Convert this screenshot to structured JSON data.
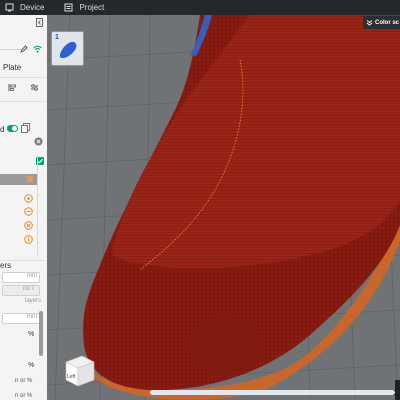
{
  "topbar": {
    "tabs": [
      {
        "label": "Device",
        "icon": "device-icon"
      },
      {
        "label": "Project",
        "icon": "project-icon"
      }
    ]
  },
  "sidebar": {
    "plate_label": "Plate",
    "layers_label": "ers",
    "input_placeholder": "mm",
    "placeholder_gray": "nic l",
    "layers_unit": "layers",
    "unit_mm": "mm",
    "unit_percent": "%",
    "unit_mm_or_percent": "n or %"
  },
  "viewport": {
    "plate_number": "1",
    "color_scheme_label": "Color sc",
    "view_cube_label": "Left",
    "progress_fraction": 0.98
  },
  "colors": {
    "accent": "#009688",
    "model_red": "#8b1c12",
    "bed_grid": "#6f7275",
    "toolbar_bg": "#25282b"
  }
}
